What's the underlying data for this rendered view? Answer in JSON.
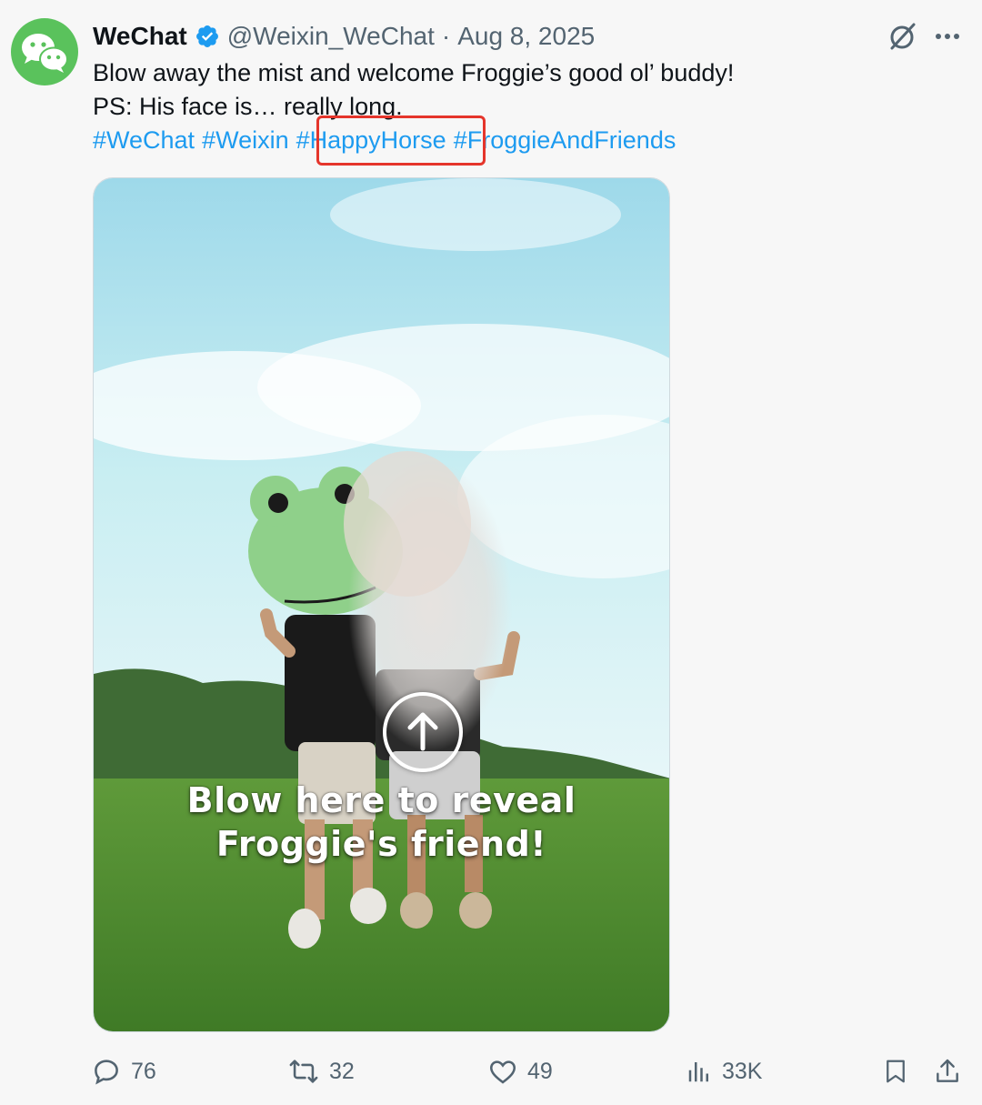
{
  "author": {
    "display_name": "WeChat",
    "handle": "@Weixin_WeChat",
    "separator": "·",
    "date": "Aug 8, 2025"
  },
  "tweet": {
    "line1": "Blow away the mist and welcome Froggie’s good ol’ buddy!",
    "line2": "PS: His face is… really long.",
    "hashtags": [
      "#WeChat",
      "#Weixin",
      "#HappyHorse",
      "#FroggieAndFriends"
    ]
  },
  "media": {
    "caption_line1": "Blow here to reveal",
    "caption_line2": "Froggie's friend!"
  },
  "actions": {
    "replies": "76",
    "reposts": "32",
    "likes": "49",
    "views": "33K"
  },
  "colors": {
    "link": "#1d9bf0",
    "highlight": "#e5352b",
    "wechat_green": "#5ac25c",
    "verified": "#1d9bf0"
  },
  "icons": [
    "wechat-logo-icon",
    "verified-badge-icon",
    "grok-icon",
    "more-icon",
    "arrow-up-icon",
    "reply-icon",
    "repost-icon",
    "like-icon",
    "views-icon",
    "bookmark-icon",
    "share-icon"
  ]
}
